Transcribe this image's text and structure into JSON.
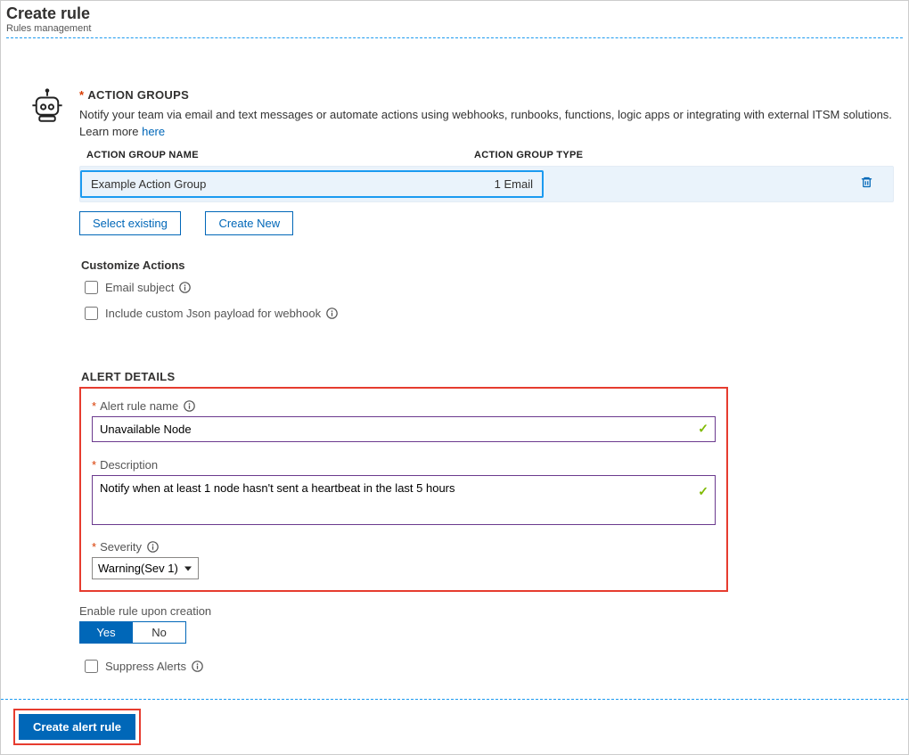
{
  "header": {
    "title": "Create rule",
    "breadcrumb": "Rules management"
  },
  "action_groups": {
    "title": "ACTION GROUPS",
    "description_pre": "Notify your team via email and text messages or automate actions using webhooks, runbooks, functions, logic apps or integrating with external ITSM solutions. Learn more ",
    "learn_more": "here",
    "col_name": "ACTION GROUP NAME",
    "col_type": "ACTION GROUP TYPE",
    "row_name": "Example Action Group",
    "row_type": "1 Email",
    "select_existing": "Select existing",
    "create_new": "Create New"
  },
  "customize": {
    "title": "Customize Actions",
    "email_subject": "Email subject",
    "json_payload": "Include custom Json payload for webhook"
  },
  "alert_details": {
    "title": "ALERT DETAILS",
    "rule_name_label": "Alert rule name",
    "rule_name_value": "Unavailable Node",
    "description_label": "Description",
    "description_value": "Notify when at least 1 node hasn't sent a heartbeat in the last 5 hours",
    "severity_label": "Severity",
    "severity_value": "Warning(Sev 1)",
    "enable_label": "Enable rule upon creation",
    "enable_yes": "Yes",
    "enable_no": "No",
    "suppress": "Suppress Alerts"
  },
  "footer": {
    "create": "Create alert rule"
  }
}
